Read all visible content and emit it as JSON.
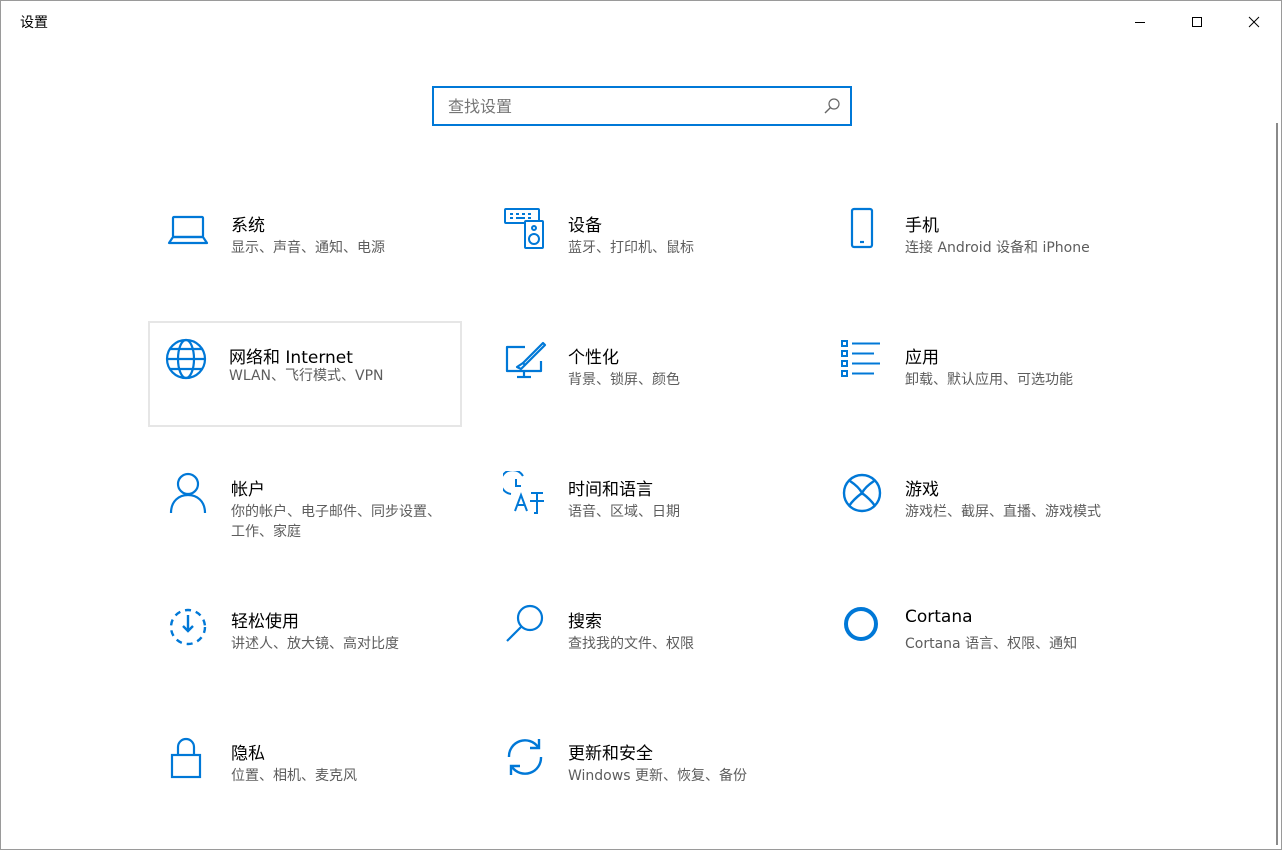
{
  "window": {
    "title": "设置"
  },
  "search": {
    "placeholder": "查找设置",
    "value": ""
  },
  "accent_color": "#0078d7",
  "tiles": [
    {
      "title": "系统",
      "description": "显示、声音、通知、电源",
      "icon": "laptop-icon"
    },
    {
      "title": "设备",
      "description": "蓝牙、打印机、鼠标",
      "icon": "devices-icon"
    },
    {
      "title": "手机",
      "description": "连接 Android 设备和 iPhone",
      "icon": "phone-icon"
    },
    {
      "title": "网络和 Internet",
      "description": "WLAN、飞行模式、VPN",
      "icon": "globe-icon"
    },
    {
      "title": "个性化",
      "description": "背景、锁屏、颜色",
      "icon": "personalization-icon"
    },
    {
      "title": "应用",
      "description": "卸载、默认应用、可选功能",
      "icon": "apps-list-icon"
    },
    {
      "title": "帐户",
      "description": "你的帐户、电子邮件、同步设置、工作、家庭",
      "icon": "person-icon"
    },
    {
      "title": "时间和语言",
      "description": "语音、区域、日期",
      "icon": "time-language-icon"
    },
    {
      "title": "游戏",
      "description": "游戏栏、截屏、直播、游戏模式",
      "icon": "xbox-icon"
    },
    {
      "title": "轻松使用",
      "description": "讲述人、放大镜、高对比度",
      "icon": "ease-of-access-icon"
    },
    {
      "title": "搜索",
      "description": "查找我的文件、权限",
      "icon": "search-magnifier-icon"
    },
    {
      "title": "Cortana",
      "description": "Cortana 语言、权限、通知",
      "icon": "cortana-icon"
    },
    {
      "title": "隐私",
      "description": "位置、相机、麦克风",
      "icon": "lock-icon"
    },
    {
      "title": "更新和安全",
      "description": "Windows 更新、恢复、备份",
      "icon": "update-sync-icon"
    }
  ]
}
